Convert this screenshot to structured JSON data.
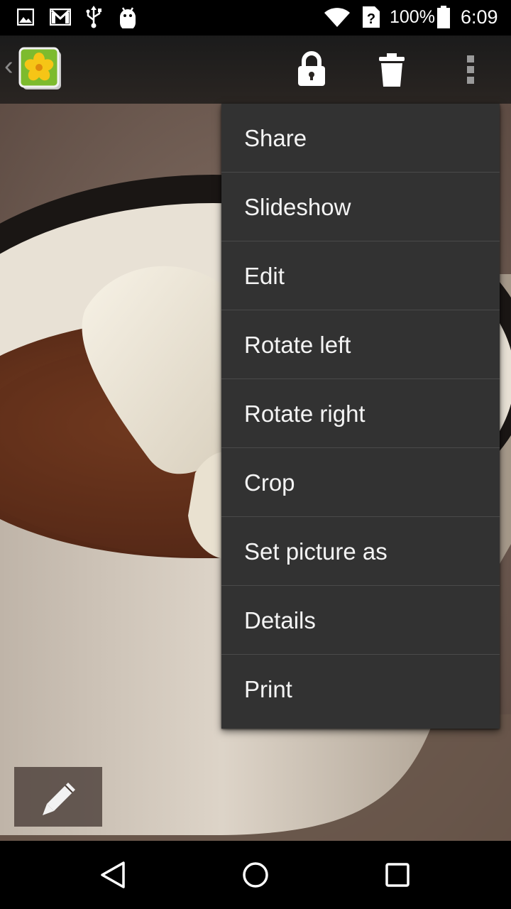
{
  "status_bar": {
    "icons": [
      "image-notification-icon",
      "gmail-notification-icon",
      "usb-icon",
      "android-debug-icon",
      "wifi-icon",
      "no-sim-icon",
      "battery-icon"
    ],
    "battery_text": "100%",
    "time": "6:09"
  },
  "action_bar": {
    "back_glyph": "‹",
    "app_icon": "gallery-flower-icon",
    "actions": [
      "lock-icon",
      "trash-icon",
      "overflow-menu-icon"
    ]
  },
  "overflow_menu": {
    "items": [
      {
        "label": "Share"
      },
      {
        "label": "Slideshow"
      },
      {
        "label": "Edit"
      },
      {
        "label": "Rotate left"
      },
      {
        "label": "Rotate right"
      },
      {
        "label": "Crop"
      },
      {
        "label": "Set picture as"
      },
      {
        "label": "Details"
      },
      {
        "label": "Print"
      }
    ]
  },
  "photo": {
    "subject": "hot-chocolate-with-marshmallow"
  },
  "edit_button": {
    "icon": "pencil-icon"
  },
  "nav_bar": {
    "buttons": [
      "back-triangle-icon",
      "home-circle-icon",
      "recents-square-icon"
    ]
  },
  "colors": {
    "menu_background": "#323232",
    "menu_divider": "#4a4a4a",
    "menu_text": "#f4f4f4",
    "status_bar": "#000000"
  }
}
